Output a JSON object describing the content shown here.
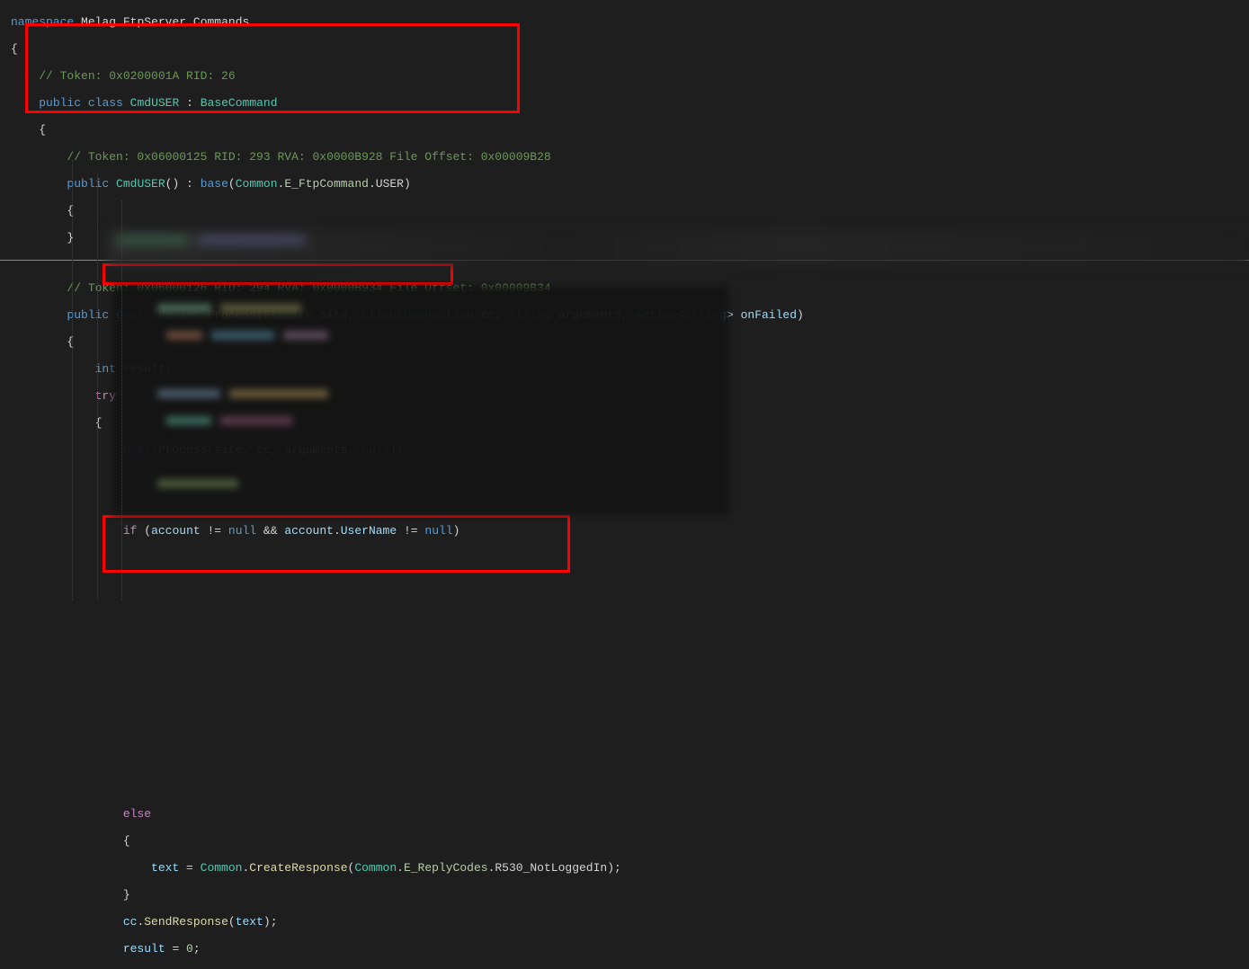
{
  "code": {
    "l1_ns": "namespace",
    "l1_a": "Melag",
    "l1_b": "FtpServer",
    "l1_c": "Commands",
    "l2": "{",
    "l3_comment": "// Token: 0x0200001A RID: 26",
    "l4_a": "public",
    "l4_b": "class",
    "l4_c": "CmdUSER",
    "l4_d": ":",
    "l4_e": "BaseCommand",
    "l5": "{",
    "l6_comment": "// Token: 0x06000125 RID: 293 RVA: 0x0000B928 File Offset: 0x00009B28",
    "l7_a": "public",
    "l7_b": "CmdUSER",
    "l7_c": "() :",
    "l7_d": "base",
    "l7_e": "(",
    "l7_f": "Common",
    "l7_g": ".",
    "l7_h": "E_FtpCommand",
    "l7_i": ".",
    "l7_j": "USER",
    "l7_k": ")",
    "l8": "{",
    "l9": "}",
    "l10_comment": "// Token: 0x06000126 RID: 294 RVA: 0x0000B934 File Offset: 0x00009B34",
    "l11_a": "public",
    "l11_b": "override",
    "l11_c": "int",
    "l11_d": "Process",
    "l11_e": "(",
    "l11_f": "FtpSite",
    "l11_g": "site",
    "l11_h": ",",
    "l11_i": "ClientConnection",
    "l11_j": "cc",
    "l11_k": ",",
    "l11_l": "string",
    "l11_m": "arguments",
    "l11_n": ",",
    "l11_o": "Action",
    "l11_p": "<",
    "l11_q": "string",
    "l11_r": ">",
    "l11_s": "onFailed",
    "l11_t": ")",
    "l12": "{",
    "l13_a": "int",
    "l13_b": "result",
    "l13_c": ";",
    "l14": "try",
    "l15": "{",
    "l16_a": "base",
    "l16_b": ".",
    "l16_c": "Process",
    "l16_d": "(",
    "l16_e": "site",
    "l16_f": ",",
    "l16_g": "cc",
    "l16_h": ",",
    "l16_i": "arguments",
    "l16_j": ",",
    "l16_k": "null",
    "l16_l": ");",
    "l17_a": "if",
    "l17_b": "(",
    "l17_c": "account",
    "l17_d": " != ",
    "l17_e": "null",
    "l17_f": " && ",
    "l17_g": "account",
    "l17_h": ".",
    "l17_i": "UserName",
    "l17_j": " != ",
    "l17_k": "null",
    "l17_l": ")",
    "l18": "else",
    "l19": "{",
    "l20_a": "text",
    "l20_b": " = ",
    "l20_c": "Common",
    "l20_d": ".",
    "l20_e": "CreateResponse",
    "l20_f": "(",
    "l20_g": "Common",
    "l20_h": ".",
    "l20_i": "E_ReplyCodes",
    "l20_j": ".",
    "l20_k": "R530_NotLoggedIn",
    "l20_l": ");",
    "l21": "}",
    "l22_a": "cc",
    "l22_b": ".",
    "l22_c": "SendResponse",
    "l22_d": "(",
    "l22_e": "text",
    "l22_f": ");",
    "l23_a": "result",
    "l23_b": " = ",
    "l23_c": "0",
    "l23_d": ";"
  }
}
